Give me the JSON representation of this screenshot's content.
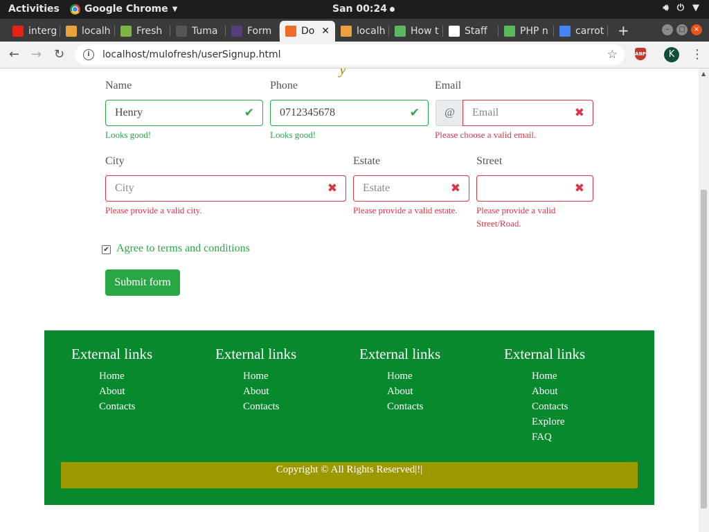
{
  "os": {
    "activities": "Activities",
    "app_name": "Google Chrome",
    "clock": "San 00:24",
    "system_icons": [
      "volume-icon",
      "power-icon",
      "caret-down-icon"
    ]
  },
  "browser": {
    "tabs": [
      {
        "title": "interg",
        "favicon_color": "#e62117"
      },
      {
        "title": "localh",
        "favicon_color": "#e8a33b"
      },
      {
        "title": "Fresh",
        "favicon_color": "#7cb342"
      },
      {
        "title": "Tuma",
        "favicon_color": "#555555"
      },
      {
        "title": "Form",
        "favicon_color": "#563d7c"
      },
      {
        "title": "Do",
        "favicon_color": "#ec6c28",
        "active": true
      },
      {
        "title": "localh",
        "favicon_color": "#e8a33b"
      },
      {
        "title": "How t",
        "favicon_color": "#5cb85c"
      },
      {
        "title": "Staff",
        "favicon_color": "#ffffff"
      },
      {
        "title": "PHP n",
        "favicon_color": "#5cb85c"
      },
      {
        "title": "carrot",
        "favicon_color": "#4285f4"
      }
    ],
    "new_tab": "+",
    "url": "localhost/mulofresh/userSignup.html",
    "profile_initial": "K",
    "extension_label": "ABP"
  },
  "form": {
    "name": {
      "label": "Name",
      "value": "Henry",
      "feedback": "Looks good!"
    },
    "phone": {
      "label": "Phone",
      "value": "0712345678",
      "feedback": "Looks good!"
    },
    "email": {
      "label": "Email",
      "prepend": "@",
      "placeholder": "Email",
      "feedback": "Please choose a valid email."
    },
    "city": {
      "label": "City",
      "placeholder": "City",
      "feedback": "Please provide a valid city."
    },
    "estate": {
      "label": "Estate",
      "placeholder": "Estate",
      "feedback": "Please provide a valid estate."
    },
    "street": {
      "label": "Street",
      "placeholder": "",
      "feedback_line1": "Please provide a valid",
      "feedback_line2": "Street/Road."
    },
    "terms": {
      "label": "Agree to terms and conditions",
      "checked": true
    },
    "submit": "Submit form"
  },
  "footer": {
    "columns": [
      {
        "heading": "External links",
        "links": [
          "Home",
          "About",
          "Contacts"
        ]
      },
      {
        "heading": "External links",
        "links": [
          "Home",
          "About",
          "Contacts"
        ]
      },
      {
        "heading": "External links",
        "links": [
          "Home",
          "About",
          "Contacts"
        ]
      },
      {
        "heading": "External links",
        "links": [
          "Home",
          "About",
          "Contacts",
          "Explore",
          "FAQ"
        ]
      }
    ],
    "copyright": "Copyright © All Rights Reserved|!|"
  },
  "colors": {
    "valid": "#28a745",
    "invalid": "#dc3545",
    "footer_bg": "#08892e",
    "copyright_bg": "#9c9800"
  }
}
